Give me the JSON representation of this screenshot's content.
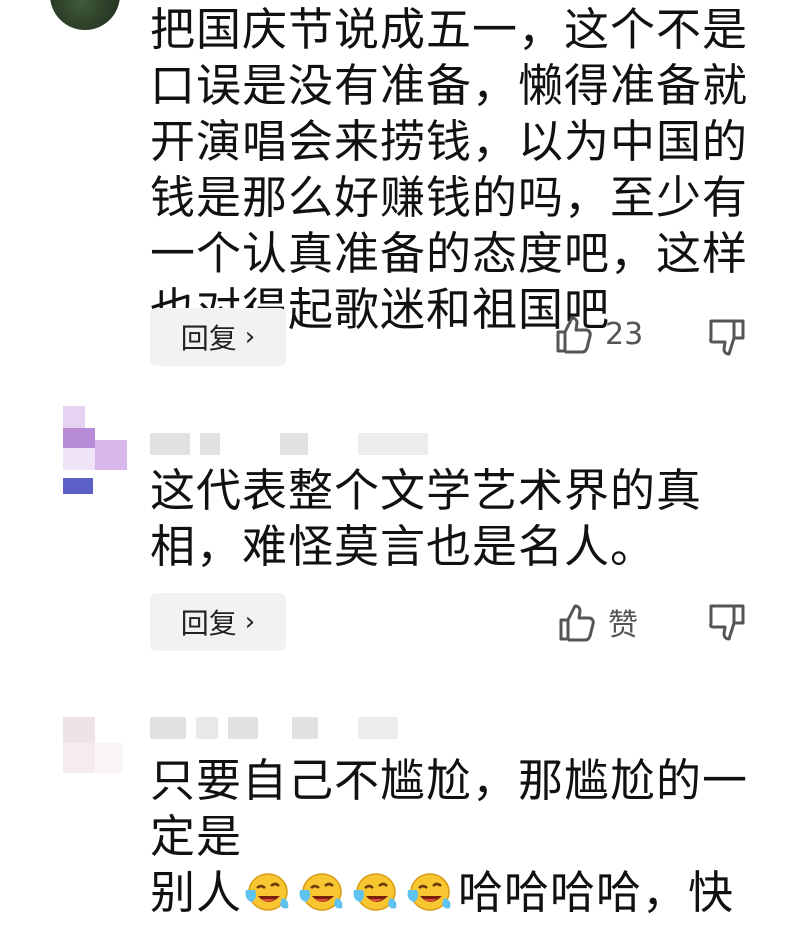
{
  "comments": [
    {
      "text": "把国庆节说成五一，这个不是口误是没有准备，懒得准备就开演唱会来捞钱，以为中国的钱是那么好赚钱的吗，至少有一个认真准备的态度吧，这样也对得起歌迷和祖国吧",
      "reply_label": "回复",
      "likes": "23"
    },
    {
      "text": "这代表整个文学艺术界的真相，难怪莫言也是名人。",
      "reply_label": "回复",
      "likes": "赞"
    },
    {
      "text_line1": "只要自己不尴尬，那尴尬的一定是",
      "text_prefix": "别人",
      "text_suffix": "哈哈哈哈，快",
      "emoji_icon": "laughing-crying-emoji",
      "emoji_count": 4
    }
  ],
  "colors": {
    "icon": "#555555",
    "button_bg": "#f2f2f2",
    "avatar_purple": "#b78bd6",
    "avatar_blue": "#5b5fc7"
  }
}
